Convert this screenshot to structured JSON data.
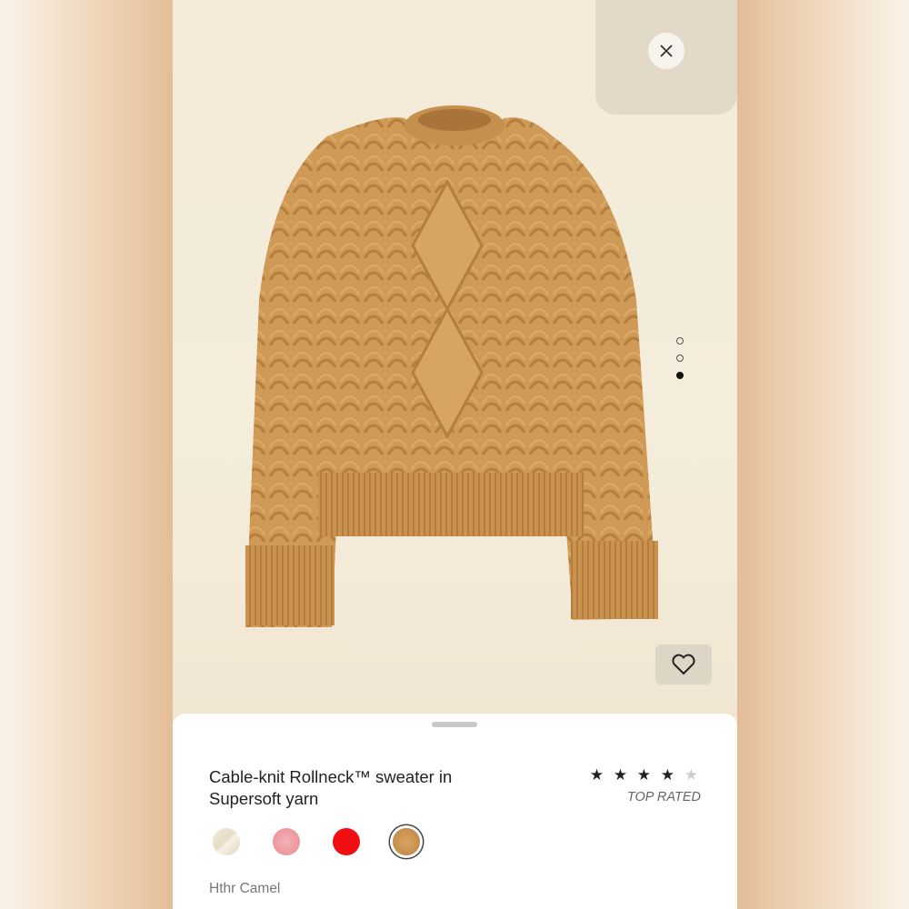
{
  "product": {
    "title": "Cable-knit Rollneck™ sweater in Supersoft yarn",
    "rating_stars": 4,
    "rating_max": 5,
    "badge": "TOP RATED",
    "selected_color": "Hthr Camel",
    "stars_filled": "★ ★ ★ ★",
    "stars_empty": "★"
  },
  "carousel": {
    "count": 3,
    "active_index": 2
  },
  "swatches": [
    {
      "color": "#ece3cf",
      "selected": false
    },
    {
      "color": "#ee9aa0",
      "selected": false
    },
    {
      "color": "#f10f13",
      "selected": false
    },
    {
      "color": "#c99048",
      "selected": true
    }
  ],
  "icons": {
    "close": "close-icon",
    "favorite": "heart-icon"
  },
  "colors": {
    "sweater": "#cf9a56",
    "sheet": "#ffffff",
    "backdrop": "#f4ecdb"
  }
}
